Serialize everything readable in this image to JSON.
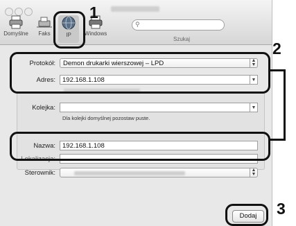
{
  "toolbar": {
    "items": [
      {
        "label": "Domyślne",
        "icon": "printer-icon"
      },
      {
        "label": "Faks",
        "icon": "fax-icon"
      },
      {
        "label": "IP",
        "icon": "globe-icon"
      },
      {
        "label": "Windows",
        "icon": "printer-icon"
      }
    ],
    "selected": "IP",
    "search_label": "Szukaj",
    "search_placeholder": ""
  },
  "form": {
    "protocol_label": "Protokół:",
    "protocol_value": "Demon drukarki wierszowej – LPD",
    "address_label": "Adres:",
    "address_value": "192.168.1.108",
    "queue_label": "Kolejka:",
    "queue_value": "",
    "queue_hint": "Dla kolejki domyślnej pozostaw puste.",
    "name_label": "Nazwa:",
    "name_value": "192.168.1.108",
    "location_label": "Lokalizacja:",
    "driver_label": "Sterownik:"
  },
  "buttons": {
    "add_label": "Dodaj"
  },
  "callouts": [
    "1",
    "2",
    "3"
  ],
  "colors": {
    "highlight": "#111111",
    "window_bg": "#e8e8e8"
  }
}
